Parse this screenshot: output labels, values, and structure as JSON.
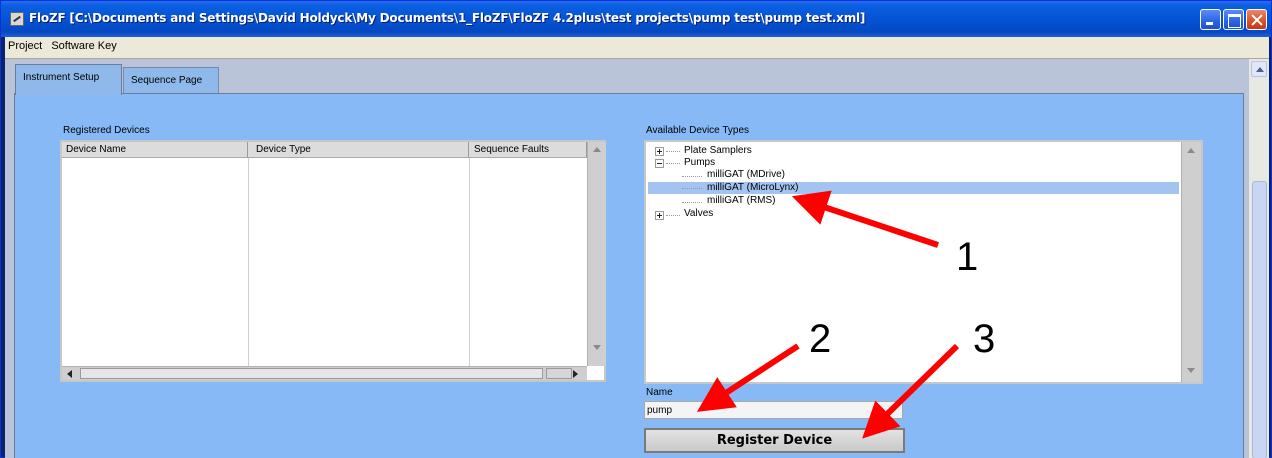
{
  "window": {
    "title": "FloZF [C:\\Documents and Settings\\David Holdyck\\My Documents\\1_FloZF\\FloZF 4.2plus\\test projects\\pump test\\pump test.xml]"
  },
  "menu": {
    "items": [
      "Project",
      "Software Key"
    ]
  },
  "tabs": [
    {
      "label": "Instrument Setup",
      "active": true
    },
    {
      "label": "Sequence Page",
      "active": false
    }
  ],
  "registered_devices": {
    "label": "Registered Devices",
    "columns": [
      "Device Name",
      "Device Type",
      "Sequence Faults"
    ],
    "rows": []
  },
  "available_device_types": {
    "label": "Available Device Types",
    "items": [
      {
        "label": "Plate Samplers",
        "level": 0,
        "expander": "plus"
      },
      {
        "label": "Pumps",
        "level": 0,
        "expander": "minus"
      },
      {
        "label": "milliGAT (MDrive)",
        "level": 1
      },
      {
        "label": "milliGAT (MicroLynx)",
        "level": 1,
        "selected": true
      },
      {
        "label": "milliGAT (RMS)",
        "level": 1
      },
      {
        "label": "Valves",
        "level": 0,
        "expander": "plus"
      }
    ]
  },
  "name_field": {
    "label": "Name",
    "value": "pump"
  },
  "register_button": {
    "label": "Register Device"
  },
  "annotations": [
    "1",
    "2",
    "3"
  ],
  "colors": {
    "title_bar": "#0554d6",
    "panel_background": "#86b9f5",
    "selected_row": "#a3c4f0",
    "annotation_arrow": "#ff0000"
  }
}
